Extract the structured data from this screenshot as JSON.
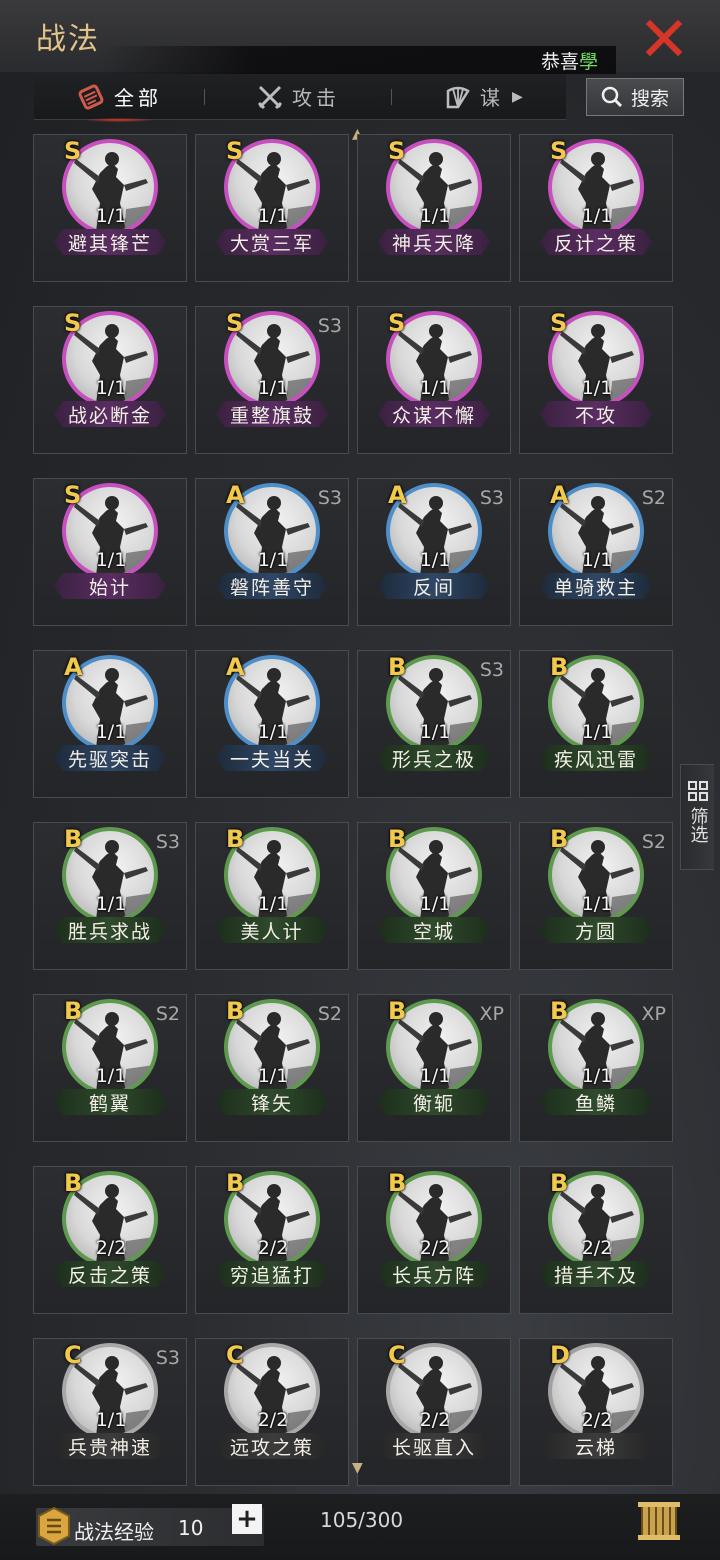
{
  "header": {
    "title": "战法",
    "notice_prefix": "恭喜",
    "notice_highlight": "學"
  },
  "tabs": [
    {
      "label": "全部",
      "icon": "scroll-icon"
    },
    {
      "label": "攻击",
      "icon": "crossed-swords-icon"
    },
    {
      "label": "谋",
      "icon": "fan-icon"
    }
  ],
  "search": {
    "label": "搜索"
  },
  "filter": {
    "label": "筛选"
  },
  "colors": {
    "S": "#c84fc0",
    "A": "#4e8fc9",
    "B": "#5e9a4e",
    "C": "#a8a8a8",
    "D": "#a0a0a0",
    "grade_text": "#f2c94c"
  },
  "cards": [
    {
      "grade": "S",
      "name": "避其锋芒",
      "count": "1/1",
      "season": ""
    },
    {
      "grade": "S",
      "name": "大赏三军",
      "count": "1/1",
      "season": ""
    },
    {
      "grade": "S",
      "name": "神兵天降",
      "count": "1/1",
      "season": ""
    },
    {
      "grade": "S",
      "name": "反计之策",
      "count": "1/1",
      "season": ""
    },
    {
      "grade": "S",
      "name": "战必断金",
      "count": "1/1",
      "season": ""
    },
    {
      "grade": "S",
      "name": "重整旗鼓",
      "count": "1/1",
      "season": "S3"
    },
    {
      "grade": "S",
      "name": "众谋不懈",
      "count": "1/1",
      "season": ""
    },
    {
      "grade": "S",
      "name": "不攻",
      "count": "1/1",
      "season": ""
    },
    {
      "grade": "S",
      "name": "始计",
      "count": "1/1",
      "season": ""
    },
    {
      "grade": "A",
      "name": "磐阵善守",
      "count": "1/1",
      "season": "S3"
    },
    {
      "grade": "A",
      "name": "反间",
      "count": "1/1",
      "season": "S3"
    },
    {
      "grade": "A",
      "name": "单骑救主",
      "count": "1/1",
      "season": "S2"
    },
    {
      "grade": "A",
      "name": "先驱突击",
      "count": "1/1",
      "season": ""
    },
    {
      "grade": "A",
      "name": "一夫当关",
      "count": "1/1",
      "season": ""
    },
    {
      "grade": "B",
      "name": "形兵之极",
      "count": "1/1",
      "season": "S3"
    },
    {
      "grade": "B",
      "name": "疾风迅雷",
      "count": "1/1",
      "season": ""
    },
    {
      "grade": "B",
      "name": "胜兵求战",
      "count": "1/1",
      "season": "S3"
    },
    {
      "grade": "B",
      "name": "美人计",
      "count": "1/1",
      "season": ""
    },
    {
      "grade": "B",
      "name": "空城",
      "count": "1/1",
      "season": ""
    },
    {
      "grade": "B",
      "name": "方圆",
      "count": "1/1",
      "season": "S2"
    },
    {
      "grade": "B",
      "name": "鹤翼",
      "count": "1/1",
      "season": "S2"
    },
    {
      "grade": "B",
      "name": "锋矢",
      "count": "1/1",
      "season": "S2"
    },
    {
      "grade": "B",
      "name": "衡轭",
      "count": "1/1",
      "season": "XP"
    },
    {
      "grade": "B",
      "name": "鱼鳞",
      "count": "1/1",
      "season": "XP"
    },
    {
      "grade": "B",
      "name": "反击之策",
      "count": "2/2",
      "season": ""
    },
    {
      "grade": "B",
      "name": "穷追猛打",
      "count": "2/2",
      "season": ""
    },
    {
      "grade": "B",
      "name": "长兵方阵",
      "count": "2/2",
      "season": ""
    },
    {
      "grade": "B",
      "name": "措手不及",
      "count": "2/2",
      "season": ""
    },
    {
      "grade": "C",
      "name": "兵贵神速",
      "count": "1/1",
      "season": "S3"
    },
    {
      "grade": "C",
      "name": "远攻之策",
      "count": "2/2",
      "season": ""
    },
    {
      "grade": "C",
      "name": "长驱直入",
      "count": "2/2",
      "season": ""
    },
    {
      "grade": "D",
      "name": "云梯",
      "count": "2/2",
      "season": ""
    }
  ],
  "footer": {
    "exp_label": "战法经验",
    "exp_value": "10",
    "plus_label": "+",
    "capacity": "105/300"
  }
}
